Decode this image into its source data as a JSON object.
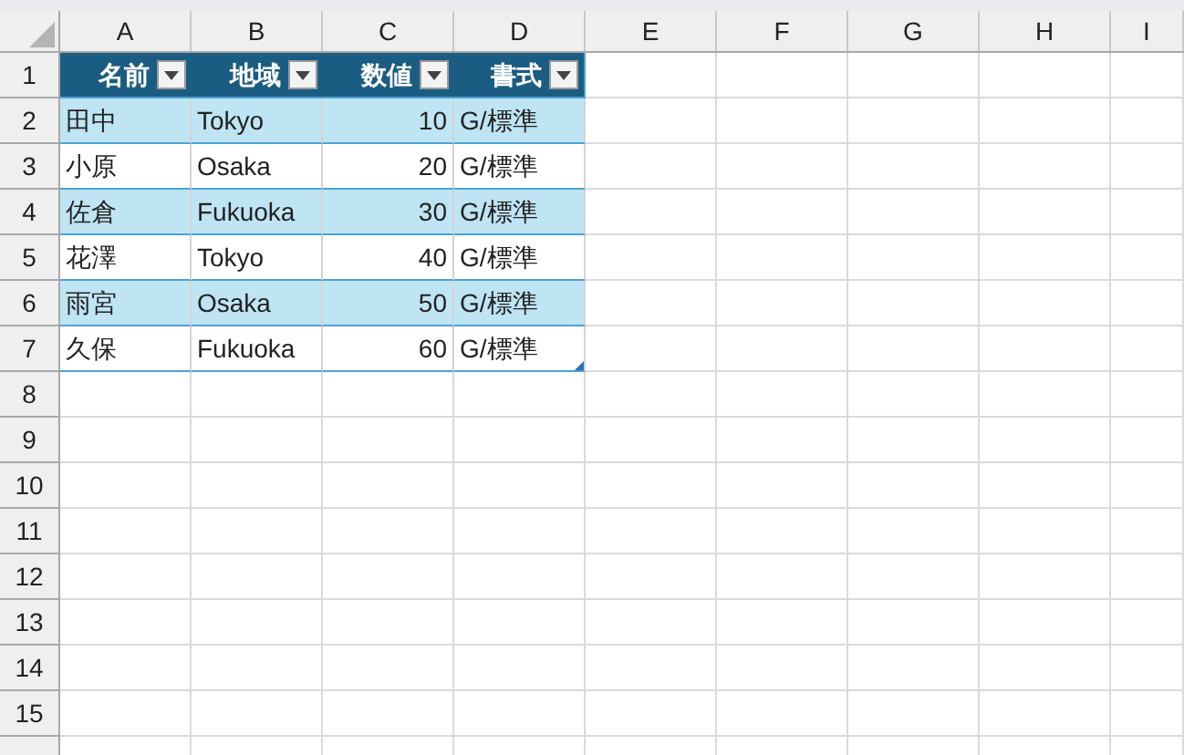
{
  "sheet": {
    "column_headers": [
      "A",
      "B",
      "C",
      "D",
      "E",
      "F",
      "G",
      "H",
      "I"
    ],
    "row_headers": [
      "1",
      "2",
      "3",
      "4",
      "5",
      "6",
      "7",
      "8",
      "9",
      "10",
      "11",
      "12",
      "13",
      "14",
      "15"
    ]
  },
  "table": {
    "columns": [
      {
        "label": "名前",
        "kind": "text",
        "filter_button": true
      },
      {
        "label": "地域",
        "kind": "text",
        "filter_button": true
      },
      {
        "label": "数値",
        "kind": "number",
        "filter_button": true
      },
      {
        "label": "書式",
        "kind": "text",
        "filter_button": true
      }
    ],
    "rows": [
      [
        "田中",
        "Tokyo",
        "10",
        "G/標準"
      ],
      [
        "小原",
        "Osaka",
        "20",
        "G/標準"
      ],
      [
        "佐倉",
        "Fukuoka",
        "30",
        "G/標準"
      ],
      [
        "花澤",
        "Tokyo",
        "40",
        "G/標準"
      ],
      [
        "雨宮",
        "Osaka",
        "50",
        "G/標準"
      ],
      [
        "久保",
        "Fukuoka",
        "60",
        "G/標準"
      ]
    ]
  }
}
